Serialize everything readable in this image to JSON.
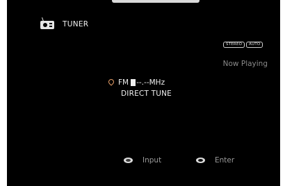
{
  "source": {
    "icon": "radio-icon",
    "label": "TUNER"
  },
  "indicators": [
    "STEREO",
    "AUTO"
  ],
  "status": "Now Playing",
  "tuning": {
    "icon": "location-pin-icon",
    "band": "FM",
    "frequency": "--.--",
    "unit": "MHz",
    "mode": "DIRECT TUNE"
  },
  "hints": {
    "input": {
      "icon": "input-knob-icon",
      "label": "Input"
    },
    "enter": {
      "icon": "enter-button-icon",
      "label": "Enter"
    }
  },
  "colors": {
    "background": "#000000",
    "text": "#f0f0f0",
    "dim_text": "#8a8a8a",
    "pin": "#e8a06a"
  }
}
